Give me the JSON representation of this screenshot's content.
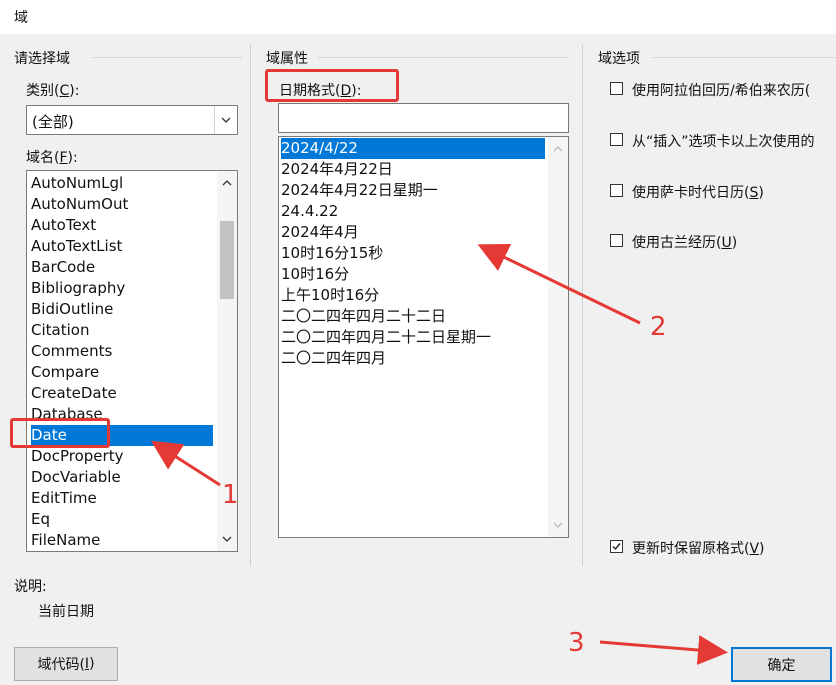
{
  "window": {
    "title": "域"
  },
  "left_group": {
    "title": "请选择域",
    "category_label": "类别",
    "category_key": "C",
    "category_value": "(全部)",
    "fieldname_label": "域名",
    "fieldname_key": "F",
    "fields": [
      "AutoNumLgl",
      "AutoNumOut",
      "AutoText",
      "AutoTextList",
      "BarCode",
      "Bibliography",
      "BidiOutline",
      "Citation",
      "Comments",
      "Compare",
      "CreateDate",
      "Database",
      "Date",
      "DocProperty",
      "DocVariable",
      "EditTime",
      "Eq",
      "FileName"
    ],
    "selected_field": "Date"
  },
  "middle_group": {
    "title": "域属性",
    "date_format_label": "日期格式",
    "date_format_key": "D",
    "date_format_value": "",
    "formats": [
      "2024/4/22",
      "2024年4月22日",
      "2024年4月22日星期一",
      "24.4.22",
      "2024年4月",
      "10时16分15秒",
      "10时16分",
      "上午10时16分",
      "二〇二四年四月二十二日",
      "二〇二四年四月二十二日星期一",
      "二〇二四年四月"
    ],
    "selected_format": "2024/4/22"
  },
  "right_group": {
    "title": "域选项",
    "options": [
      {
        "label": "使用阿拉伯回历/希伯来农历(",
        "checked": false
      },
      {
        "label": "从“插入”选项卡以上次使用的",
        "checked": false
      },
      {
        "label": "使用萨卡时代日历(",
        "key": "S",
        "suffix": ")",
        "checked": false
      },
      {
        "label": "使用古兰经历(",
        "key": "U",
        "suffix": ")",
        "checked": false
      }
    ],
    "preserve_label": "更新时保留原格式(",
    "preserve_key": "V",
    "preserve_suffix": ")",
    "preserve_checked": true
  },
  "description": {
    "label": "说明:",
    "text": "当前日期"
  },
  "buttons": {
    "field_codes": "域代码(",
    "field_codes_key": "I",
    "field_codes_suffix": ")",
    "ok": "确定"
  },
  "annotations": {
    "step1": "1",
    "step2": "2",
    "step3": "3",
    "color": "#e53935"
  },
  "colors": {
    "selection": "#0078d7",
    "dialog_bg": "#f0f0f0"
  }
}
